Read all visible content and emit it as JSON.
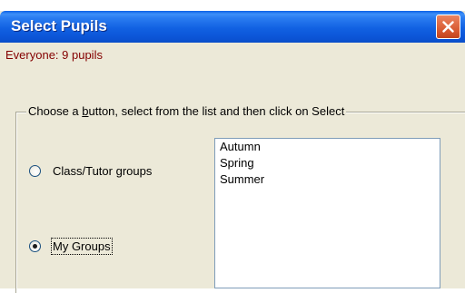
{
  "window": {
    "title": "Select Pupils",
    "close_icon": "close-icon"
  },
  "status": {
    "text": "Everyone: 9 pupils"
  },
  "groupbox": {
    "legend_pre": "Choose a ",
    "legend_access": "b",
    "legend_post": "utton, select from the list and then click on Select"
  },
  "options": [
    {
      "label": "Class/Tutor groups",
      "checked": false
    },
    {
      "label": "My Groups",
      "checked": true
    }
  ],
  "list": {
    "items": [
      "Autumn",
      "Spring",
      "Summer"
    ]
  },
  "colors": {
    "titlebar": "#0a54d6",
    "status_text": "#840000",
    "window_bg": "#ece9d8",
    "close_button": "#d3532b"
  }
}
